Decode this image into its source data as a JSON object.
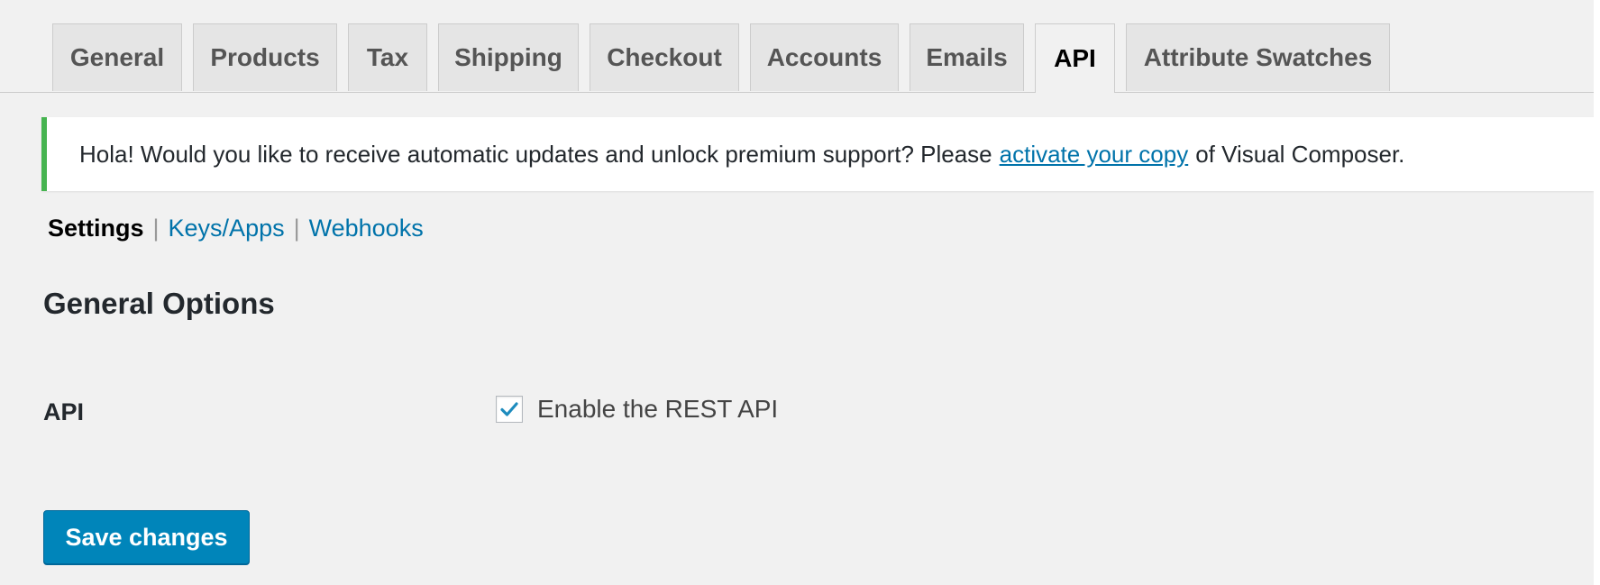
{
  "tabs": [
    {
      "label": "General",
      "active": false
    },
    {
      "label": "Products",
      "active": false
    },
    {
      "label": "Tax",
      "active": false
    },
    {
      "label": "Shipping",
      "active": false
    },
    {
      "label": "Checkout",
      "active": false
    },
    {
      "label": "Accounts",
      "active": false
    },
    {
      "label": "Emails",
      "active": false
    },
    {
      "label": "API",
      "active": true
    },
    {
      "label": "Attribute Swatches",
      "active": false
    }
  ],
  "notice": {
    "text_before": "Hola! Would you like to receive automatic updates and unlock premium support? Please",
    "link_text": "activate your copy",
    "text_after": "of Visual Composer.",
    "accent_color": "#46b450"
  },
  "subnav": {
    "current": "Settings",
    "separator": "|",
    "links": [
      "Keys/Apps",
      "Webhooks"
    ]
  },
  "section": {
    "title": "General Options"
  },
  "api_row": {
    "label": "API",
    "checkbox_label": "Enable the REST API",
    "checked": true,
    "check_color": "#1e8cbe"
  },
  "buttons": {
    "save_label": "Save changes",
    "primary_color": "#0085ba"
  },
  "icons": {
    "checkbox_check": "checkmark-icon"
  }
}
